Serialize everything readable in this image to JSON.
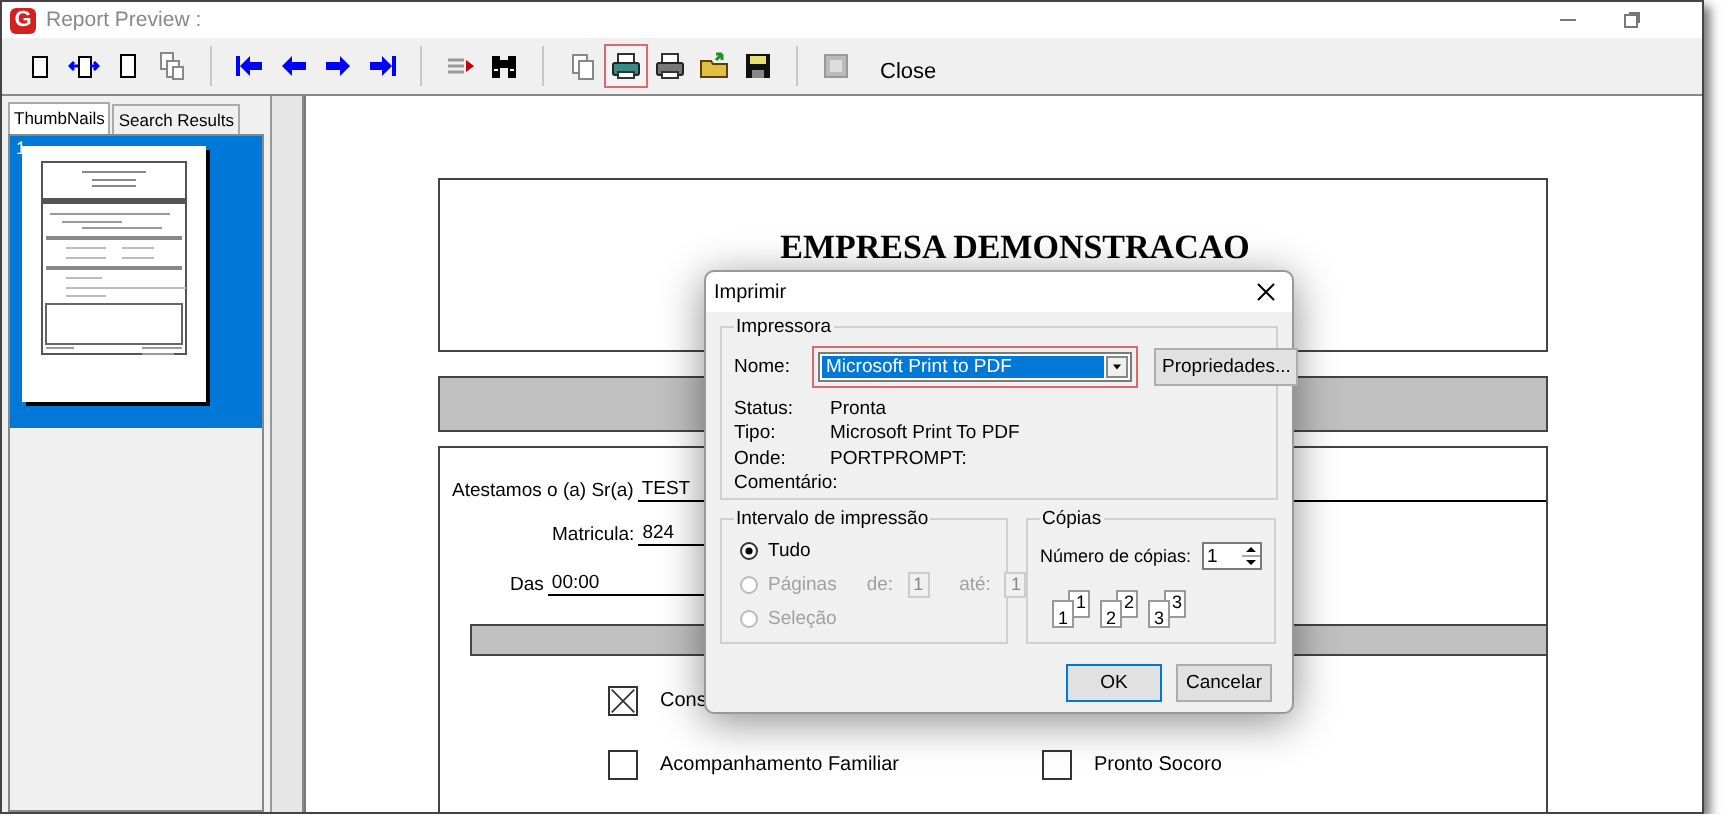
{
  "window": {
    "logo": "G",
    "title": "Report Preview :"
  },
  "toolbar": [
    {
      "kind": "one-page",
      "highlighted": false
    },
    {
      "kind": "page-width",
      "highlighted": false
    },
    {
      "kind": "full-page",
      "highlighted": false
    },
    {
      "kind": "multi-page",
      "highlighted": false
    },
    {
      "kind": "separator"
    },
    {
      "kind": "first",
      "highlighted": false
    },
    {
      "kind": "prev",
      "highlighted": false
    },
    {
      "kind": "next",
      "highlighted": false
    },
    {
      "kind": "last",
      "highlighted": false
    },
    {
      "kind": "separator"
    },
    {
      "kind": "goto",
      "highlighted": false
    },
    {
      "kind": "find",
      "highlighted": false
    },
    {
      "kind": "separator"
    },
    {
      "kind": "copy",
      "highlighted": false
    },
    {
      "kind": "print-setup",
      "highlighted": true
    },
    {
      "kind": "print",
      "highlighted": false
    },
    {
      "kind": "open",
      "highlighted": false
    },
    {
      "kind": "save",
      "highlighted": false
    },
    {
      "kind": "separator"
    },
    {
      "kind": "export",
      "highlighted": false
    },
    {
      "kind": "close",
      "label": "Close",
      "highlighted": false
    }
  ],
  "sidebar": {
    "tabs": [
      {
        "label": "ThumbNails",
        "selected": true
      },
      {
        "label": "Search Results",
        "selected": false
      }
    ],
    "thumbnails": [
      {
        "label": "1",
        "selected": true
      }
    ]
  },
  "report": {
    "title": "EMPRESA DEMONSTRACAO",
    "fields": [
      {
        "label": "Atestamos o (a) Sr(a)",
        "value": "TEST"
      },
      {
        "label": "Matricula:",
        "value": "824"
      },
      {
        "label": "Das",
        "value": "00:00"
      }
    ],
    "option_rows": [
      [
        {
          "label": "Cons",
          "checked": true
        }
      ],
      [
        {
          "label": "Acompanhamento Familiar",
          "checked": false
        },
        {
          "label": "Pronto Socoro",
          "checked": false
        }
      ]
    ]
  },
  "dialog": {
    "title": "Imprimir",
    "printer": {
      "group": "Impressora",
      "name_label": "Nome:",
      "name": "Microsoft Print to PDF",
      "highlighted": true,
      "properties_button": "Propriedades...",
      "info": [
        {
          "label": "Status:",
          "value": "Pronta"
        },
        {
          "label": "Tipo:",
          "value": "Microsoft Print To PDF"
        },
        {
          "label": "Onde:",
          "value": "PORTPROMPT:"
        },
        {
          "label": "Comentário:"
        }
      ]
    },
    "range": {
      "group": "Intervalo de impressão",
      "options": [
        {
          "label": "Tudo",
          "selected": true,
          "disabled": false
        },
        {
          "label": "Páginas",
          "selected": false,
          "disabled": true
        },
        {
          "label": "Seleção",
          "selected": false,
          "disabled": true
        }
      ],
      "from_label": "de:",
      "from": "1",
      "to_label": "até:",
      "to": "1"
    },
    "copies": {
      "group": "Cópias",
      "label": "Número de cópias:",
      "value": "1",
      "collate": [
        {
          "back": "1",
          "front": "1"
        },
        {
          "back": "2",
          "front": "2"
        },
        {
          "back": "3",
          "front": "3"
        }
      ]
    },
    "buttons": [
      "OK",
      "Cancelar"
    ]
  }
}
